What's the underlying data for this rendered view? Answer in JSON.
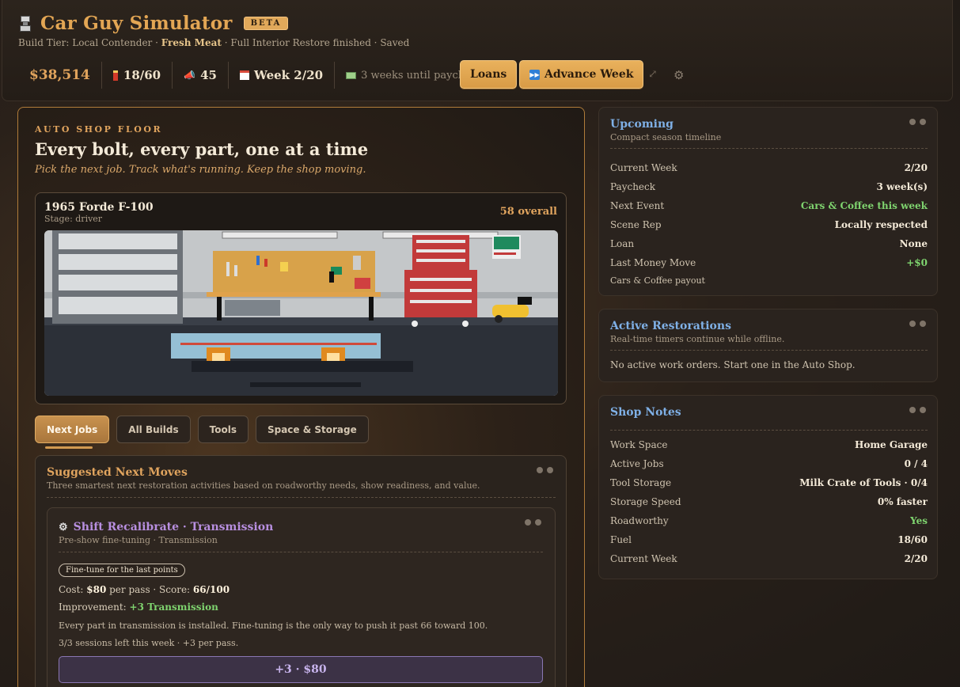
{
  "header": {
    "title": "Car Guy Simulator",
    "badge": "BETA",
    "subline_prefix": "Build Tier: Local Contender · ",
    "subline_bold": "Fresh Meat",
    "subline_suffix": " · Full Interior Restore finished · Saved",
    "stats": {
      "money": "$38,514",
      "fuel": "18/60",
      "rep": "45",
      "week": "Week 2/20",
      "paycheck": "3 weeks until paycheck"
    },
    "loans_label": "Loans",
    "advance_label": "Advance Week"
  },
  "shop": {
    "eyebrow": "AUTO SHOP FLOOR",
    "title": "Every bolt, every part, one at a time",
    "tagline": "Pick the next job. Track what's running. Keep the shop moving.",
    "car": {
      "name": "1965 Forde F-100",
      "stage": "Stage: driver",
      "overall": "58 overall"
    },
    "tabs": [
      "Next Jobs",
      "All Builds",
      "Tools",
      "Space & Storage"
    ],
    "moves": {
      "title": "Suggested Next Moves",
      "subtitle": "Three smartest next restoration activities based on roadworthy needs, show readiness, and value.",
      "job": {
        "title": "Shift Recalibrate · Transmission",
        "subtitle": "Pre-show fine-tuning · Transmission",
        "pill": "Fine-tune for the last points",
        "cost_label": "Cost: ",
        "cost_value": "$80",
        "cost_mid": " per pass · Score: ",
        "score_value": "66/100",
        "improvement_label": "Improvement: ",
        "improvement_value": "+3 Transmission",
        "desc": "Every part in transmission is installed. Fine-tuning is the only way to push it past 66 toward 100.",
        "sessions": "3/3 sessions left this week · +3 per pass.",
        "button": "+3 · $80"
      }
    }
  },
  "upcoming": {
    "title": "Upcoming",
    "subtitle": "Compact season timeline",
    "rows": [
      {
        "k": "Current Week",
        "v": "2/20"
      },
      {
        "k": "Paycheck",
        "v": "3 week(s)"
      },
      {
        "k": "Next Event",
        "v": "Cars & Coffee this week"
      },
      {
        "k": "Scene Rep",
        "v": "Locally respected"
      },
      {
        "k": "Loan",
        "v": "None"
      },
      {
        "k": "Last Money Move",
        "v": "+$0"
      },
      {
        "k": "Cars & Coffee payout",
        "v": ""
      }
    ]
  },
  "restorations": {
    "title": "Active Restorations",
    "subtitle": "Real-time timers continue while offline.",
    "empty": "No active work orders. Start one in the Auto Shop."
  },
  "notes": {
    "title": "Shop Notes",
    "rows": [
      {
        "k": "Work Space",
        "v": "Home Garage"
      },
      {
        "k": "Active Jobs",
        "v": "0 / 4"
      },
      {
        "k": "Tool Storage",
        "v": "Milk Crate of Tools · 0/4"
      },
      {
        "k": "Storage Speed",
        "v": "0% faster"
      },
      {
        "k": "Roadworthy",
        "v": "Yes"
      },
      {
        "k": "Fuel",
        "v": "18/60"
      },
      {
        "k": "Current Week",
        "v": "2/20"
      }
    ]
  },
  "colors": {
    "accent": "#e0a45e",
    "positive": "#7fd46f",
    "side_title": "#7fb0e6",
    "job_title": "#b88fe0"
  }
}
